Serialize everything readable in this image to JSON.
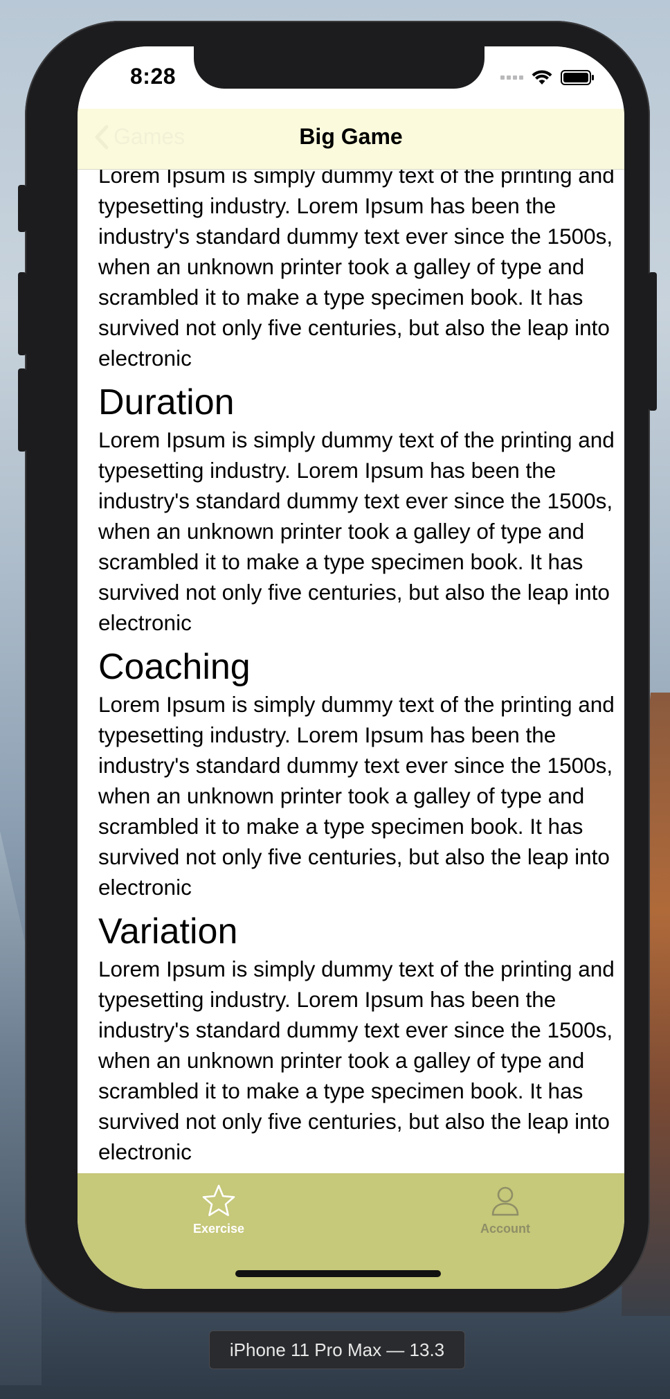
{
  "status_bar": {
    "time": "8:28"
  },
  "nav": {
    "back_label": "Games",
    "title": "Big Game"
  },
  "sections": [
    {
      "heading": "",
      "body": "Lorem Ipsum is simply dummy text of the printing and typesetting industry. Lorem Ipsum has been the industry's standard dummy text ever since the 1500s, when an unknown printer took a galley of type and scrambled it to make a type specimen book. It has survived not only five centuries, but also the leap into electronic"
    },
    {
      "heading": "Duration",
      "body": "Lorem Ipsum is simply dummy text of the printing and typesetting industry. Lorem Ipsum has been the industry's standard dummy text ever since the 1500s, when an unknown printer took a galley of type and scrambled it to make a type specimen book. It has survived not only five centuries, but also the leap into electronic"
    },
    {
      "heading": "Coaching",
      "body": "Lorem Ipsum is simply dummy text of the printing and typesetting industry. Lorem Ipsum has been the industry's standard dummy text ever since the 1500s, when an unknown printer took a galley of type and scrambled it to make a type specimen book. It has survived not only five centuries, but also the leap into electronic"
    },
    {
      "heading": "Variation",
      "body": "Lorem Ipsum is simply dummy text of the printing and typesetting industry. Lorem Ipsum has been the industry's standard dummy text ever since the 1500s, when an unknown printer took a galley of type and scrambled it to make a type specimen book. It has survived not only five centuries, but also the leap into electronic"
    }
  ],
  "tab_bar": {
    "tabs": [
      {
        "label": "Exercise",
        "icon": "star-icon",
        "selected": true
      },
      {
        "label": "Account",
        "icon": "person-icon",
        "selected": false
      }
    ]
  },
  "simulator": {
    "device_label": "iPhone 11 Pro Max — 13.3"
  },
  "colors": {
    "nav_background": "#fbfadc",
    "tab_bar_background": "#c6c87a",
    "tab_selected": "#ffffff",
    "tab_unselected": "#8e8f66"
  }
}
